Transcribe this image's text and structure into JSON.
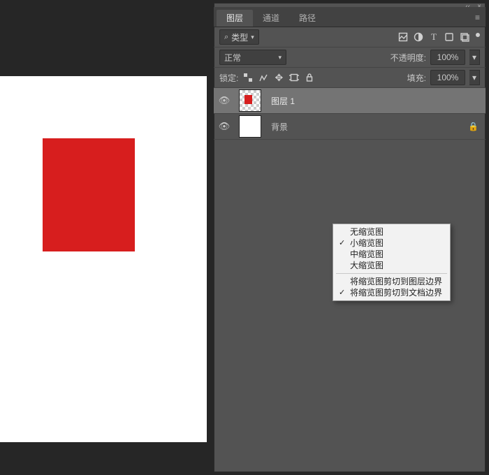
{
  "panel": {
    "tabs": [
      "图层",
      "通道",
      "路径"
    ],
    "active_tab": 0,
    "menu_icon": "panel-menu-icon",
    "collapse_icon": "collapse-icon",
    "close_icon": "close-icon"
  },
  "filter": {
    "kind_label": "类型",
    "search_icon": "search-icon",
    "icons": [
      "image-filter-icon",
      "adjustment-filter-icon",
      "type-filter-icon",
      "shape-filter-icon",
      "smart-filter-icon"
    ],
    "toggle_icon": "filter-toggle-icon"
  },
  "blend": {
    "mode": "正常",
    "opacity_label": "不透明度:",
    "opacity_value": "100%"
  },
  "lock": {
    "label": "锁定:",
    "icons": [
      "lock-transparent-icon",
      "lock-image-icon",
      "lock-position-icon",
      "lock-artboard-icon",
      "lock-all-icon"
    ],
    "fill_label": "填充:",
    "fill_value": "100%"
  },
  "layers": [
    {
      "name": "图层 1",
      "visible": true,
      "thumb": "transparent-red",
      "selected": true,
      "locked": false
    },
    {
      "name": "背景",
      "visible": true,
      "thumb": "white",
      "selected": false,
      "locked": true
    }
  ],
  "context_menu": {
    "items": [
      {
        "label": "无缩览图",
        "checked": false
      },
      {
        "label": "小缩览图",
        "checked": true
      },
      {
        "label": "中缩览图",
        "checked": false
      },
      {
        "label": "大缩览图",
        "checked": false
      }
    ],
    "items2": [
      {
        "label": "将缩览图剪切到图层边界",
        "checked": false
      },
      {
        "label": "将缩览图剪切到文档边界",
        "checked": true
      }
    ]
  }
}
